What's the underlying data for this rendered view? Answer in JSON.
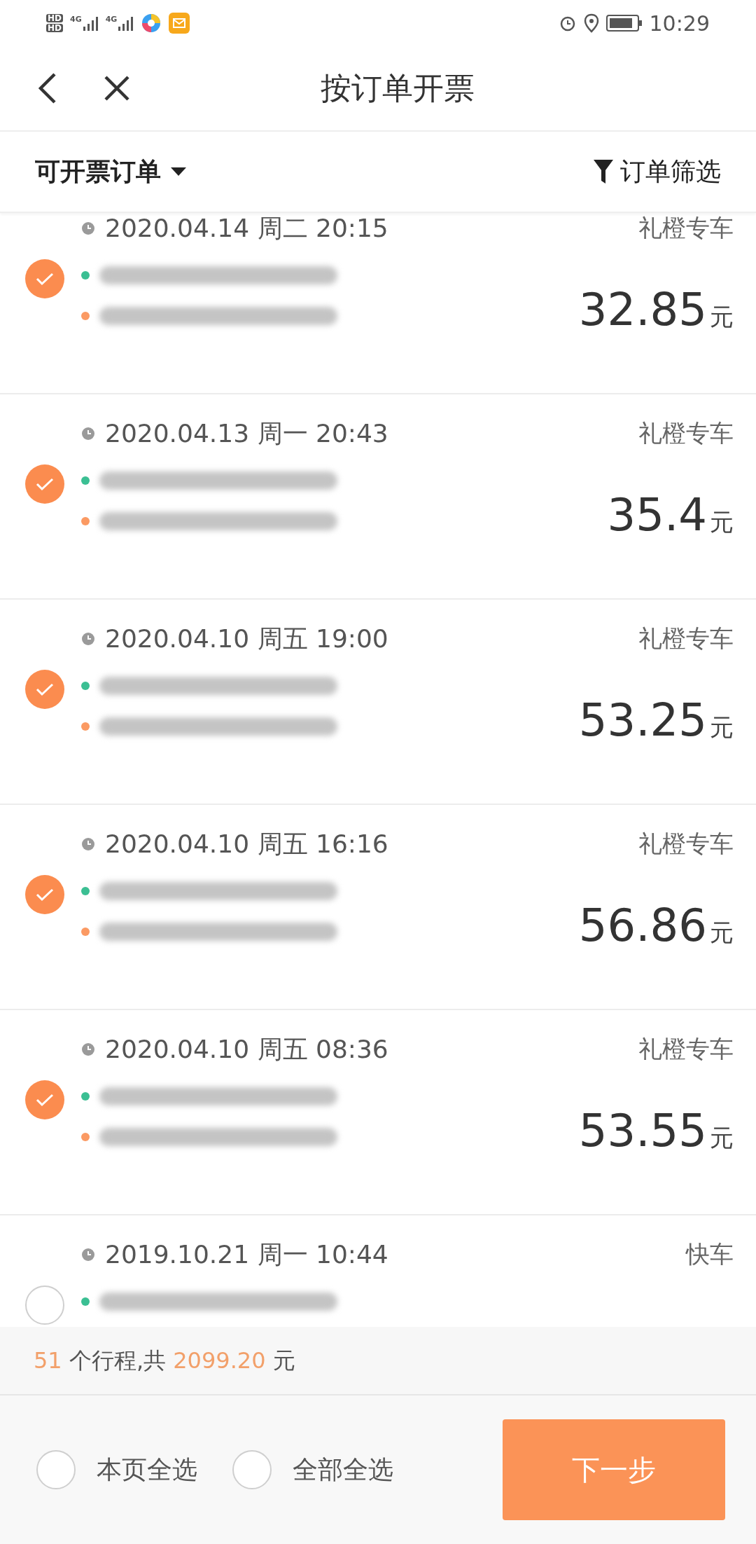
{
  "status_bar": {
    "hd_badges": [
      "HD",
      "HD"
    ],
    "networks": [
      "4G",
      "4G"
    ],
    "time": "10:29"
  },
  "nav": {
    "title": "按订单开票"
  },
  "filter_bar": {
    "tab": "可开票订单",
    "filter": "订单筛选"
  },
  "orders": [
    {
      "date": "2020.04.14 周二 20:15",
      "type": "礼橙专车",
      "checked": true,
      "stops": [
        {
          "kind": "start"
        },
        {
          "kind": "end"
        }
      ],
      "price": "32.85",
      "unit": "元"
    },
    {
      "date": "2020.04.13 周一 20:43",
      "type": "礼橙专车",
      "checked": true,
      "stops": [
        {
          "kind": "start"
        },
        {
          "kind": "end"
        }
      ],
      "price": "35.4",
      "unit": "元"
    },
    {
      "date": "2020.04.10 周五 19:00",
      "type": "礼橙专车",
      "checked": true,
      "stops": [
        {
          "kind": "start"
        },
        {
          "kind": "end"
        }
      ],
      "price": "53.25",
      "unit": "元"
    },
    {
      "date": "2020.04.10 周五 16:16",
      "type": "礼橙专车",
      "checked": true,
      "stops": [
        {
          "kind": "start"
        },
        {
          "kind": "end"
        }
      ],
      "price": "56.86",
      "unit": "元"
    },
    {
      "date": "2020.04.10 周五 08:36",
      "type": "礼橙专车",
      "checked": true,
      "stops": [
        {
          "kind": "start"
        },
        {
          "kind": "end"
        }
      ],
      "price": "53.55",
      "unit": "元"
    },
    {
      "date": "2019.10.21 周一 10:44",
      "type": "快车",
      "checked": false,
      "stops": [
        {
          "kind": "start"
        }
      ]
    }
  ],
  "summary": [
    {
      "kind": "highlight",
      "text": "51"
    },
    {
      "kind": "plain",
      "text": " 个行程,共 "
    },
    {
      "kind": "highlight",
      "text": "2099.20"
    },
    {
      "kind": "plain",
      "text": " 元"
    }
  ],
  "footer": {
    "options": [
      {
        "label": "本页全选",
        "checked": false
      },
      {
        "label": "全部全选",
        "checked": false
      }
    ],
    "next": "下一步"
  }
}
